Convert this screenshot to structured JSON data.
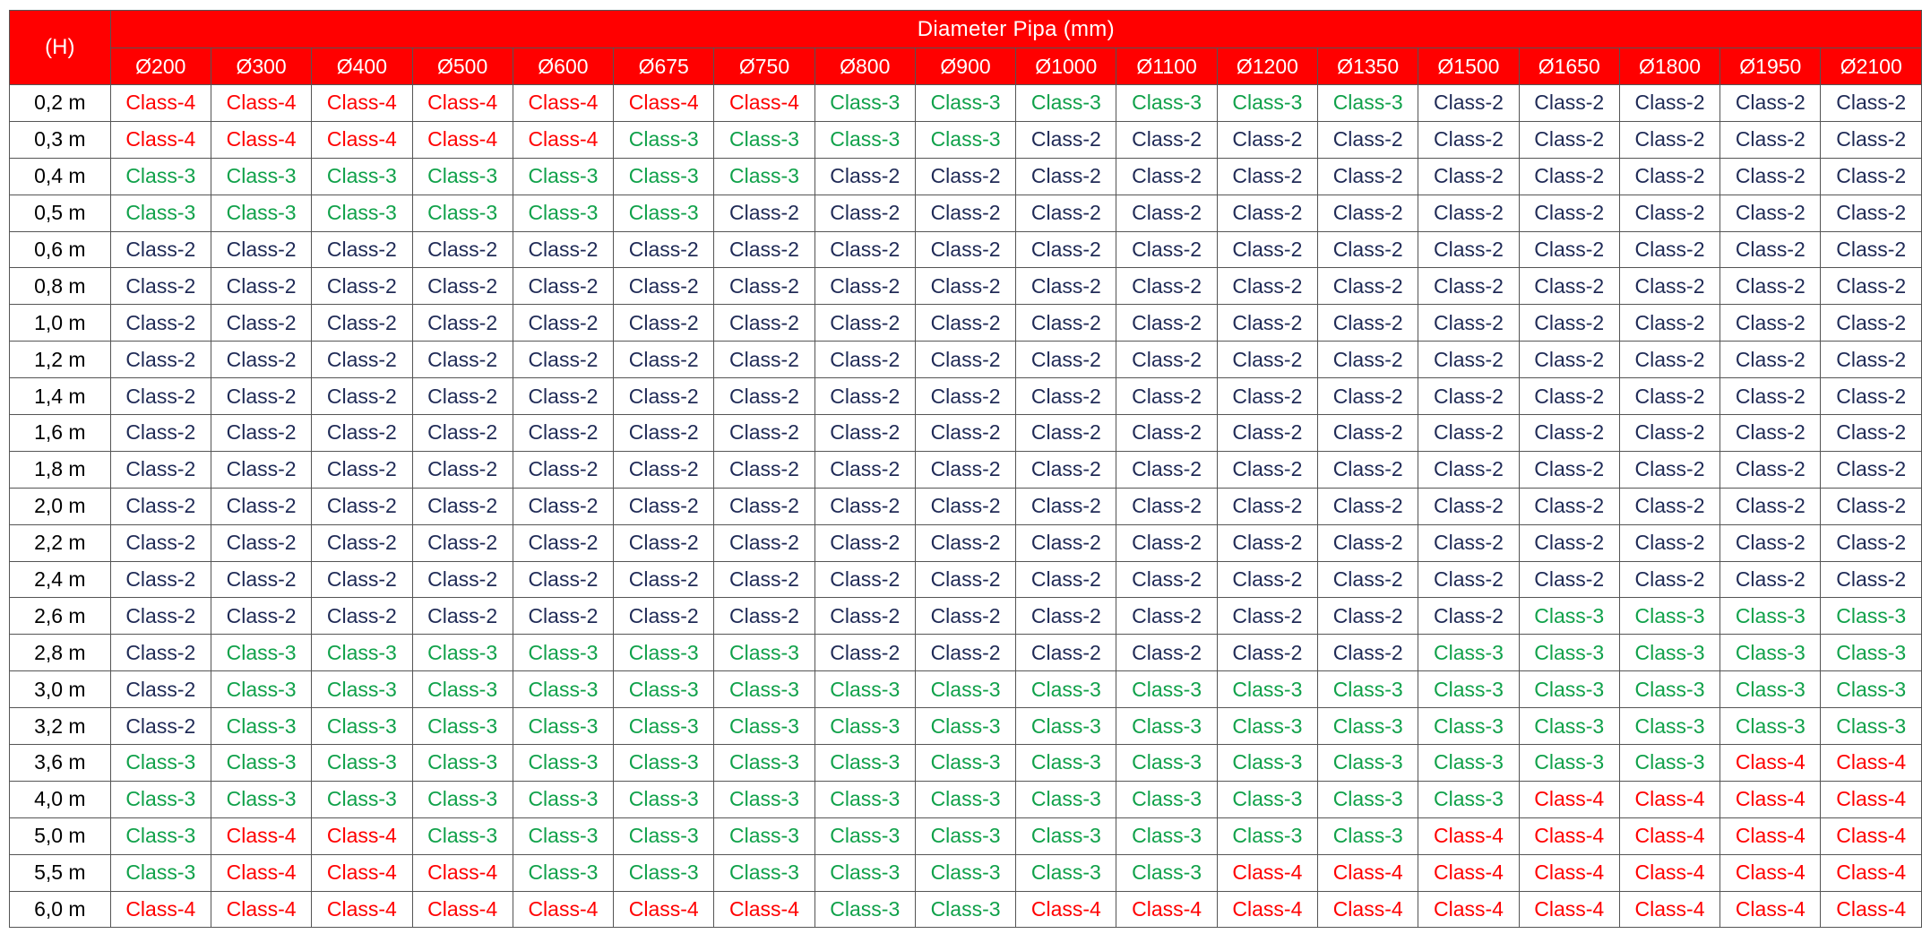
{
  "table": {
    "corner_label": "(H)",
    "header_title": "Diameter Pipa (mm)",
    "diameters": [
      "Ø200",
      "Ø300",
      "Ø400",
      "Ø500",
      "Ø600",
      "Ø675",
      "Ø750",
      "Ø800",
      "Ø900",
      "Ø1000",
      "Ø1100",
      "Ø1200",
      "Ø1350",
      "Ø1500",
      "Ø1650",
      "Ø1800",
      "Ø1950",
      "Ø2100"
    ],
    "class_labels": {
      "2": "Class-2",
      "3": "Class-3",
      "4": "Class-4"
    },
    "class_colors": {
      "2": "#1f2a56",
      "3": "#10a14a",
      "4": "#ff0000"
    },
    "rows": [
      {
        "h": "0,2 m",
        "classes": [
          4,
          4,
          4,
          4,
          4,
          4,
          4,
          3,
          3,
          3,
          3,
          3,
          3,
          2,
          2,
          2,
          2,
          2
        ]
      },
      {
        "h": "0,3 m",
        "classes": [
          4,
          4,
          4,
          4,
          4,
          3,
          3,
          3,
          3,
          2,
          2,
          2,
          2,
          2,
          2,
          2,
          2,
          2
        ]
      },
      {
        "h": "0,4 m",
        "classes": [
          3,
          3,
          3,
          3,
          3,
          3,
          3,
          2,
          2,
          2,
          2,
          2,
          2,
          2,
          2,
          2,
          2,
          2
        ]
      },
      {
        "h": "0,5 m",
        "classes": [
          3,
          3,
          3,
          3,
          3,
          3,
          2,
          2,
          2,
          2,
          2,
          2,
          2,
          2,
          2,
          2,
          2,
          2
        ]
      },
      {
        "h": "0,6 m",
        "classes": [
          2,
          2,
          2,
          2,
          2,
          2,
          2,
          2,
          2,
          2,
          2,
          2,
          2,
          2,
          2,
          2,
          2,
          2
        ]
      },
      {
        "h": "0,8 m",
        "classes": [
          2,
          2,
          2,
          2,
          2,
          2,
          2,
          2,
          2,
          2,
          2,
          2,
          2,
          2,
          2,
          2,
          2,
          2
        ]
      },
      {
        "h": "1,0 m",
        "classes": [
          2,
          2,
          2,
          2,
          2,
          2,
          2,
          2,
          2,
          2,
          2,
          2,
          2,
          2,
          2,
          2,
          2,
          2
        ]
      },
      {
        "h": "1,2 m",
        "classes": [
          2,
          2,
          2,
          2,
          2,
          2,
          2,
          2,
          2,
          2,
          2,
          2,
          2,
          2,
          2,
          2,
          2,
          2
        ]
      },
      {
        "h": "1,4 m",
        "classes": [
          2,
          2,
          2,
          2,
          2,
          2,
          2,
          2,
          2,
          2,
          2,
          2,
          2,
          2,
          2,
          2,
          2,
          2
        ]
      },
      {
        "h": "1,6 m",
        "classes": [
          2,
          2,
          2,
          2,
          2,
          2,
          2,
          2,
          2,
          2,
          2,
          2,
          2,
          2,
          2,
          2,
          2,
          2
        ]
      },
      {
        "h": "1,8 m",
        "classes": [
          2,
          2,
          2,
          2,
          2,
          2,
          2,
          2,
          2,
          2,
          2,
          2,
          2,
          2,
          2,
          2,
          2,
          2
        ]
      },
      {
        "h": "2,0 m",
        "classes": [
          2,
          2,
          2,
          2,
          2,
          2,
          2,
          2,
          2,
          2,
          2,
          2,
          2,
          2,
          2,
          2,
          2,
          2
        ]
      },
      {
        "h": "2,2 m",
        "classes": [
          2,
          2,
          2,
          2,
          2,
          2,
          2,
          2,
          2,
          2,
          2,
          2,
          2,
          2,
          2,
          2,
          2,
          2
        ]
      },
      {
        "h": "2,4 m",
        "classes": [
          2,
          2,
          2,
          2,
          2,
          2,
          2,
          2,
          2,
          2,
          2,
          2,
          2,
          2,
          2,
          2,
          2,
          2
        ]
      },
      {
        "h": "2,6 m",
        "classes": [
          2,
          2,
          2,
          2,
          2,
          2,
          2,
          2,
          2,
          2,
          2,
          2,
          2,
          2,
          3,
          3,
          3,
          3
        ]
      },
      {
        "h": "2,8 m",
        "classes": [
          2,
          3,
          3,
          3,
          3,
          3,
          3,
          2,
          2,
          2,
          2,
          2,
          2,
          3,
          3,
          3,
          3,
          3
        ]
      },
      {
        "h": "3,0 m",
        "classes": [
          2,
          3,
          3,
          3,
          3,
          3,
          3,
          3,
          3,
          3,
          3,
          3,
          3,
          3,
          3,
          3,
          3,
          3
        ]
      },
      {
        "h": "3,2 m",
        "classes": [
          2,
          3,
          3,
          3,
          3,
          3,
          3,
          3,
          3,
          3,
          3,
          3,
          3,
          3,
          3,
          3,
          3,
          3
        ]
      },
      {
        "h": "3,6 m",
        "classes": [
          3,
          3,
          3,
          3,
          3,
          3,
          3,
          3,
          3,
          3,
          3,
          3,
          3,
          3,
          3,
          3,
          4,
          4
        ]
      },
      {
        "h": "4,0 m",
        "classes": [
          3,
          3,
          3,
          3,
          3,
          3,
          3,
          3,
          3,
          3,
          3,
          3,
          3,
          3,
          4,
          4,
          4,
          4
        ]
      },
      {
        "h": "5,0 m",
        "classes": [
          3,
          4,
          4,
          3,
          3,
          3,
          3,
          3,
          3,
          3,
          3,
          3,
          3,
          4,
          4,
          4,
          4,
          4
        ]
      },
      {
        "h": "5,5 m",
        "classes": [
          3,
          4,
          4,
          4,
          3,
          3,
          3,
          3,
          3,
          3,
          3,
          4,
          4,
          4,
          4,
          4,
          4,
          4
        ]
      },
      {
        "h": "6,0 m",
        "classes": [
          4,
          4,
          4,
          4,
          4,
          4,
          4,
          3,
          3,
          4,
          4,
          4,
          4,
          4,
          4,
          4,
          4,
          4
        ]
      }
    ]
  }
}
